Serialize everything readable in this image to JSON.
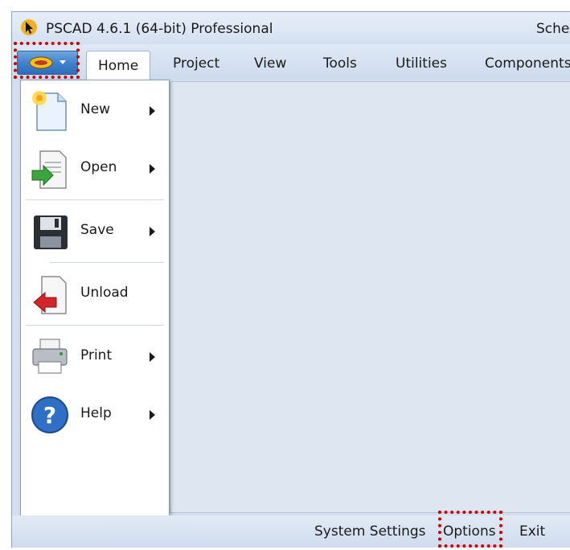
{
  "window": {
    "title": "PSCAD 4.6.1 (64-bit) Professional",
    "title_right_clipped": "Sche"
  },
  "ribbon": {
    "tabs": [
      {
        "label": "Home",
        "active": true
      },
      {
        "label": "Project"
      },
      {
        "label": "View"
      },
      {
        "label": "Tools"
      },
      {
        "label": "Utilities"
      },
      {
        "label": "Components"
      }
    ]
  },
  "app_menu": {
    "items": [
      {
        "label": "New",
        "icon": "new-document-icon",
        "submenu": true
      },
      {
        "label": "Open",
        "icon": "open-document-icon",
        "submenu": true
      },
      {
        "label": "Save",
        "icon": "floppy-disk-icon",
        "submenu": true
      },
      {
        "label": "Unload",
        "icon": "unload-icon",
        "submenu": false
      },
      {
        "label": "Print",
        "icon": "printer-icon",
        "submenu": true
      },
      {
        "label": "Help",
        "icon": "help-icon",
        "submenu": true
      }
    ]
  },
  "footer": {
    "system_settings": "System Settings",
    "options": "Options",
    "exit": "Exit"
  },
  "colors": {
    "highlight": "#d40000",
    "accent": "#3f7fcb"
  }
}
